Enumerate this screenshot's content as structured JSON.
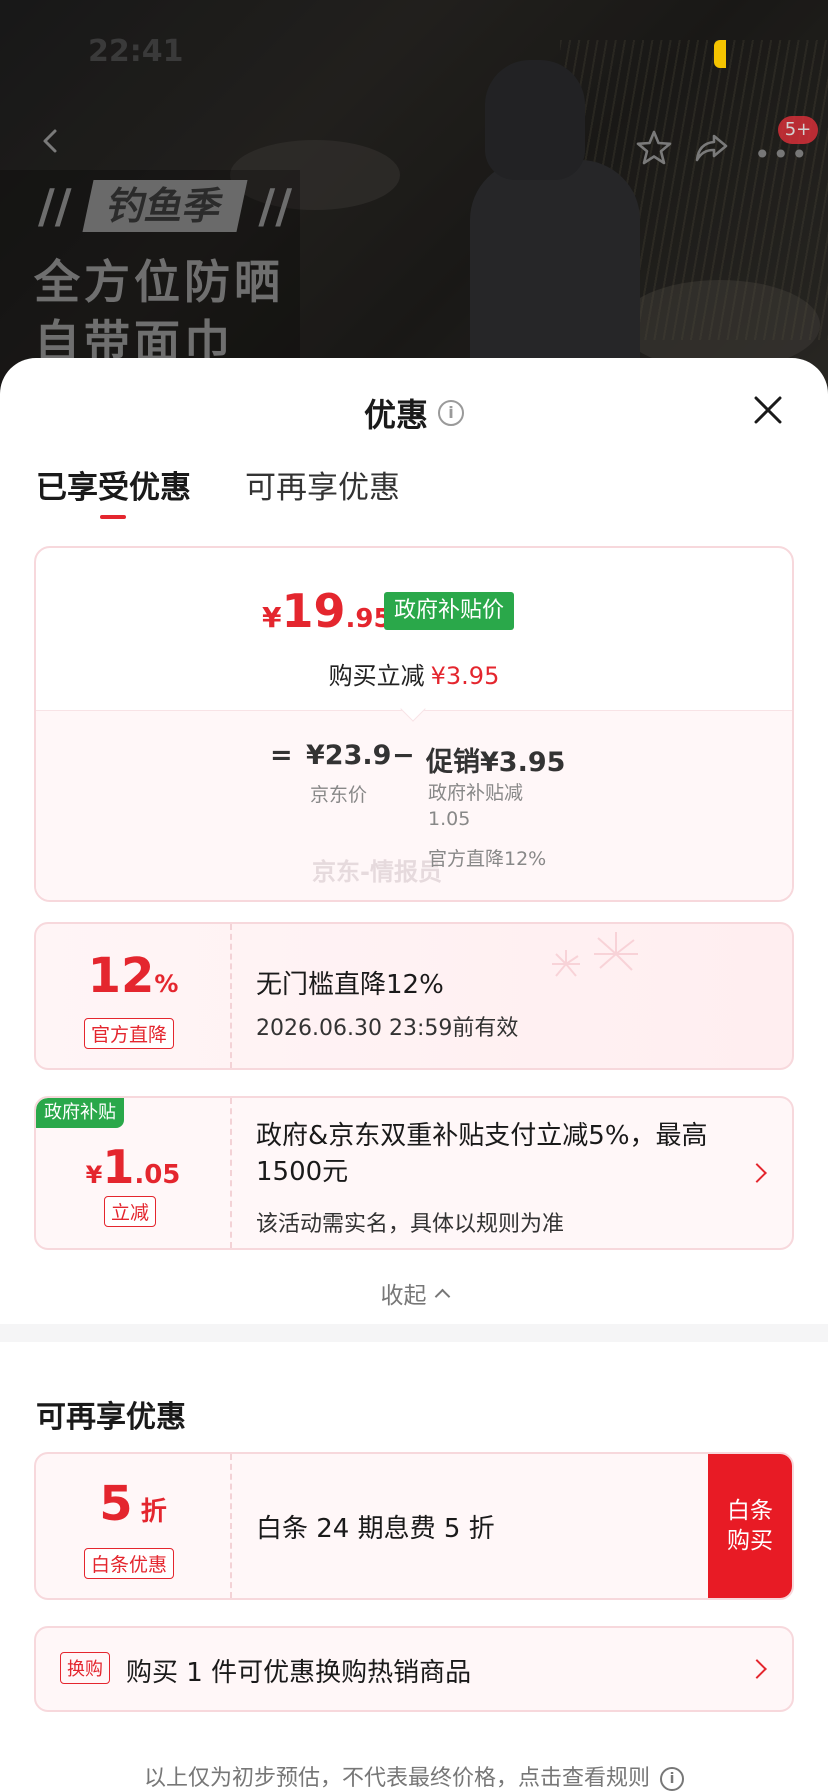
{
  "status_bar": {
    "time": "22:41"
  },
  "nav": {
    "badge": "5+"
  },
  "hero": {
    "tag": "钓鱼季",
    "line1": "全方位防晒",
    "line2": "自带面巾"
  },
  "sheet": {
    "title": "优惠",
    "tabs": [
      {
        "label": "已享受优惠",
        "active": true
      },
      {
        "label": "可再享优惠",
        "active": false
      }
    ]
  },
  "price_card": {
    "currency": "¥",
    "price_int": "19",
    "price_dec": ".95",
    "gov_badge": "政府补贴价",
    "reduce_label": "购买立减",
    "reduce_amount": "¥3.95",
    "eq": "=",
    "jd_price": "¥23.9",
    "minus": "−",
    "promo_price": "促销¥3.95",
    "jd_label": "京东价",
    "sub_note": "政府补贴减 1.05",
    "sub_note2": "官方直降12%",
    "watermark": "京东-情报员"
  },
  "coupons": [
    {
      "value": "12",
      "unit": "%",
      "tag": "官方直降",
      "title": "无门槛直降12%",
      "desc": "2026.06.30 23:59前有效"
    },
    {
      "corner_tag": "政府补贴",
      "currency": "¥",
      "value_int": "1",
      "value_dec": ".05",
      "tag": "立减",
      "title": "政府&京东双重补贴支付立减5%，最高1500元",
      "desc": "该活动需实名，具体以规则为准"
    }
  ],
  "collapse_label": "收起",
  "more_section": {
    "title": "可再享优惠",
    "baitiao": {
      "value": "5",
      "unit": "折",
      "tag": "白条优惠",
      "title": "白条 24 期息费 5 折",
      "buy_label": "白条购买"
    },
    "exchange": {
      "tag": "换购",
      "title": "购买 1 件可优惠换购热销商品"
    }
  },
  "footnote": "以上仅为初步预估，不代表最终价格，点击查看规则",
  "colors": {
    "accent": "#e4262e",
    "gov_green": "#2aa84a",
    "buy_red": "#e81b25"
  },
  "icons": [
    "back-icon",
    "star-icon",
    "share-icon",
    "more-icon",
    "info-icon",
    "close-icon",
    "chevron-right-icon",
    "chevron-up-icon"
  ]
}
